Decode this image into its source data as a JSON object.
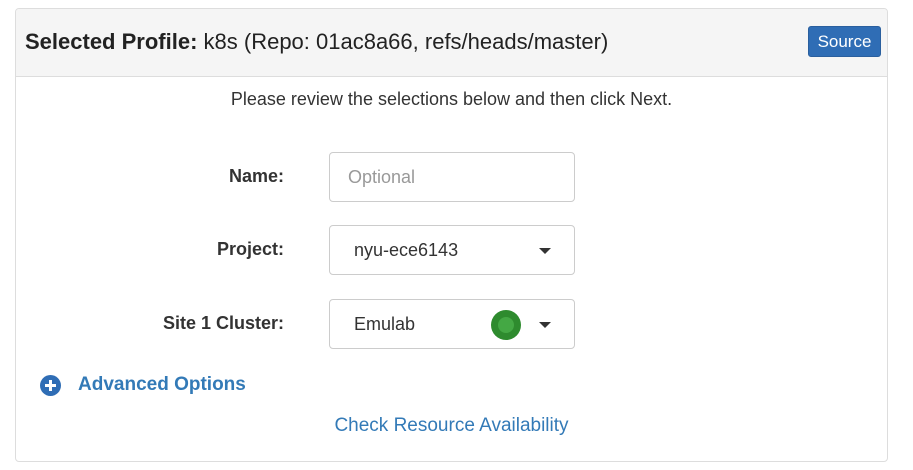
{
  "header": {
    "label": "Selected Profile:",
    "profile_info": "k8s (Repo: 01ac8a66, refs/heads/master)",
    "source_button": "Source"
  },
  "intro": "Please review the selections below and then click Next.",
  "form": {
    "name": {
      "label": "Name:",
      "placeholder": "Optional",
      "value": ""
    },
    "project": {
      "label": "Project:",
      "value": "nyu-ece6143"
    },
    "cluster": {
      "label": "Site 1 Cluster:",
      "value": "Emulab",
      "status_color": "#2e8b2e"
    }
  },
  "advanced_options": "Advanced Options",
  "check_availability": "Check Resource Availability",
  "colors": {
    "primary": "#337ab7",
    "button": "#2f6db5"
  }
}
